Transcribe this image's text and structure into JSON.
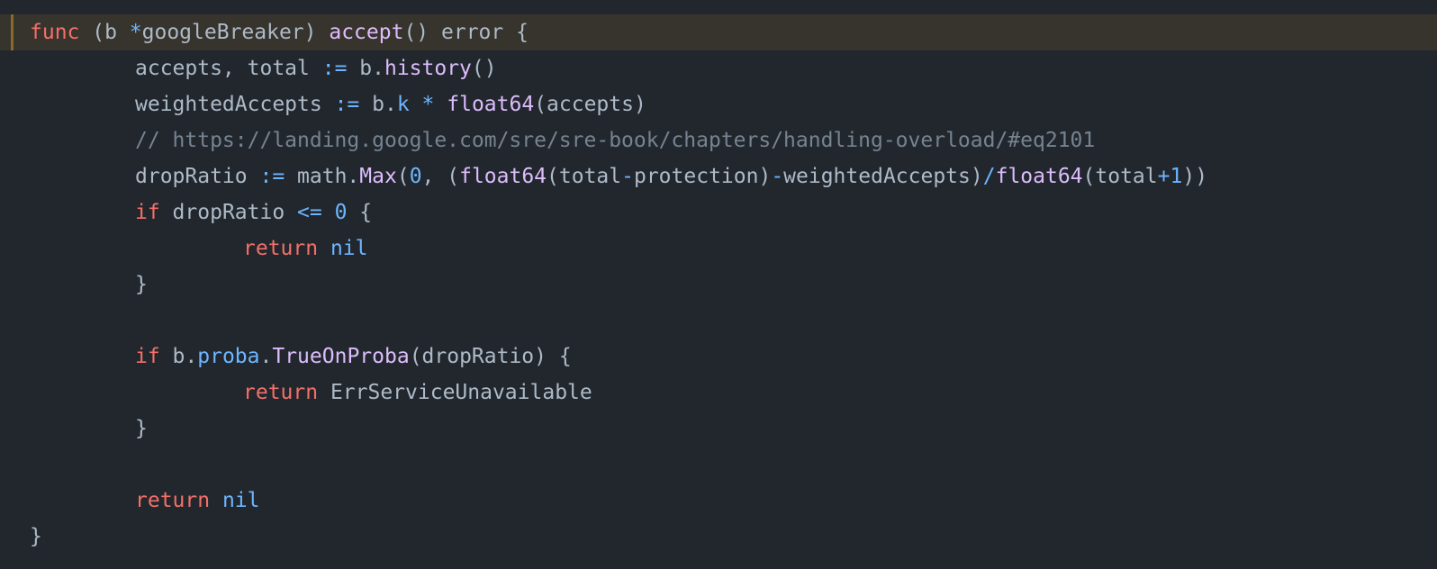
{
  "lines": [
    {
      "t1": "func",
      "t2": " (b ",
      "t3": "*",
      "t4": "googleBreaker) ",
      "t5": "accept",
      "t6": "() error {"
    },
    {
      "t1": "accepts, total ",
      "t2": ":=",
      "t3": " b.",
      "t4": "history",
      "t5": "()"
    },
    {
      "t1": "weightedAccepts ",
      "t2": ":=",
      "t3": " b.",
      "t4": "k",
      "t5": " ",
      "t6": "*",
      "t7": " ",
      "t8": "float64",
      "t9": "(accepts)"
    },
    {
      "comment": "// https://landing.google.com/sre/sre-book/chapters/handling-overload/#eq2101"
    },
    {
      "t1": "dropRatio ",
      "t2": ":=",
      "t3": " math.",
      "t4": "Max",
      "t5": "(",
      "t6": "0",
      "t7": ", (",
      "t8": "float64",
      "t9": "(total",
      "t10": "-",
      "t11": "protection)",
      "t12": "-",
      "t13": "weightedAccepts)",
      "t14": "/",
      "t15": "float64",
      "t16": "(total",
      "t17": "+",
      "t18": "1",
      "t19": "))"
    },
    {
      "t1": "if",
      "t2": " dropRatio ",
      "t3": "<=",
      "t4": " ",
      "t5": "0",
      "t6": " {"
    },
    {
      "t1": "return",
      "t2": " ",
      "t3": "nil"
    },
    {
      "t1": "}"
    },
    {},
    {
      "t1": "if",
      "t2": " b.",
      "t3": "proba",
      "t4": ".",
      "t5": "TrueOnProba",
      "t6": "(dropRatio) {"
    },
    {
      "t1": "return",
      "t2": " ErrServiceUnavailable"
    },
    {
      "t1": "}"
    },
    {},
    {
      "t1": "return",
      "t2": " ",
      "t3": "nil"
    },
    {
      "t1": "}"
    }
  ],
  "colors": {
    "background": "#22272e",
    "keyword": "#f47067",
    "function": "#dcbdfb",
    "builtin": "#6cb6ff",
    "text": "#adbac7",
    "comment": "#768390",
    "highlight": "#37332d"
  }
}
